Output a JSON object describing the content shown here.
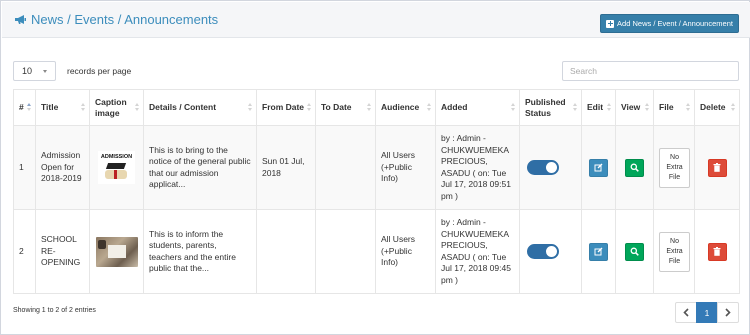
{
  "header": {
    "title": "News / Events / Announcements",
    "title_icon": "bullhorn-icon",
    "add_button_label": "Add News / Event / Announcement"
  },
  "controls": {
    "page_length_value": "10",
    "page_length_label": "records per page",
    "search_placeholder": "Search"
  },
  "table": {
    "columns": [
      "#",
      "Title",
      "Caption image",
      "Details / Content",
      "From Date",
      "To Date",
      "Audience",
      "Added",
      "Published Status",
      "Edit",
      "View",
      "File",
      "Delete"
    ],
    "rows": [
      {
        "num": "1",
        "title": "Admission Open for 2018-2019",
        "caption_image": "ADMISSION",
        "details": "This is to bring to the notice of the general public that our admission applicat...",
        "from_date": "Sun 01 Jul, 2018",
        "to_date": "",
        "audience": "All Users (+Public Info)",
        "added": "by : Admin - CHUKWUEMEKA PRECIOUS, ASADU ( on: Tue Jul 17, 2018 09:51 pm )",
        "published": true,
        "file": "No Extra File"
      },
      {
        "num": "2",
        "title": "SCHOOL RE-OPENING",
        "caption_image": "",
        "details": "This is to inform the students, parents, teachers and the entire public that the...",
        "from_date": "",
        "to_date": "",
        "audience": "All Users (+Public Info)",
        "added": "by : Admin - CHUKWUEMEKA PRECIOUS, ASADU ( on: Tue Jul 17, 2018 09:45 pm )",
        "published": true,
        "file": "No Extra File"
      }
    ]
  },
  "footer": {
    "info": "Showing 1 to 2 of 2 entries",
    "current_page": "1"
  },
  "colors": {
    "accent": "#3c8dbc",
    "edit": "#3c8dbc",
    "view": "#00a65a",
    "delete": "#dd4b39",
    "toggle_on": "#2f6ea5"
  }
}
